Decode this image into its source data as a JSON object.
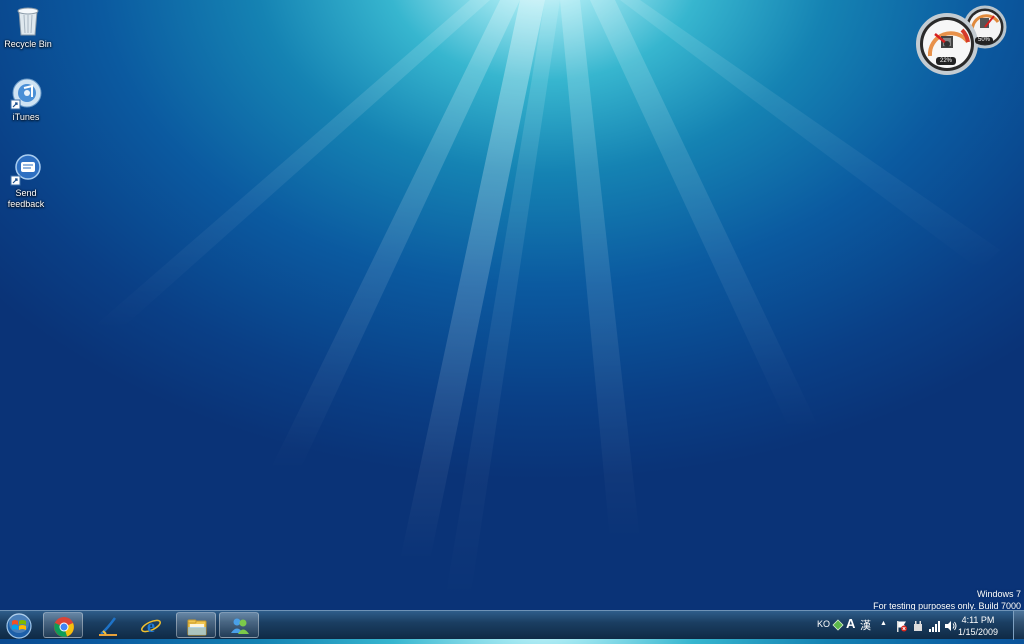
{
  "desktop": {
    "icons": [
      {
        "label": "Recycle Bin",
        "icon": "recycle-bin-icon"
      },
      {
        "label": "iTunes",
        "icon": "itunes-icon"
      },
      {
        "label": "Send feedback",
        "icon": "send-feedback-icon"
      }
    ]
  },
  "gadget": {
    "name": "cpu-meter-gadget",
    "cpu_percent": "22%",
    "memory_percent": "50%"
  },
  "watermark": {
    "line1": "Windows 7",
    "line2": "For testing purposes only. Build 7000"
  },
  "taskbar": {
    "start_icon": "windows-start-icon",
    "pinned": [
      {
        "icon": "chrome-icon",
        "active": true
      },
      {
        "icon": "live-writer-icon",
        "active": false
      },
      {
        "icon": "internet-explorer-icon",
        "active": false
      },
      {
        "icon": "windows-explorer-icon",
        "active": true
      },
      {
        "icon": "messenger-icon",
        "active": true
      }
    ],
    "tray": {
      "language": "KO",
      "ime_mode": "A",
      "hanja": "漢",
      "time": "4:11 PM",
      "date": "1/15/2009"
    }
  },
  "colors": {
    "taskbar": "#1b3f63",
    "desktop_deep": "#0a3f86",
    "desktop_glow": "#9ee6f0"
  }
}
